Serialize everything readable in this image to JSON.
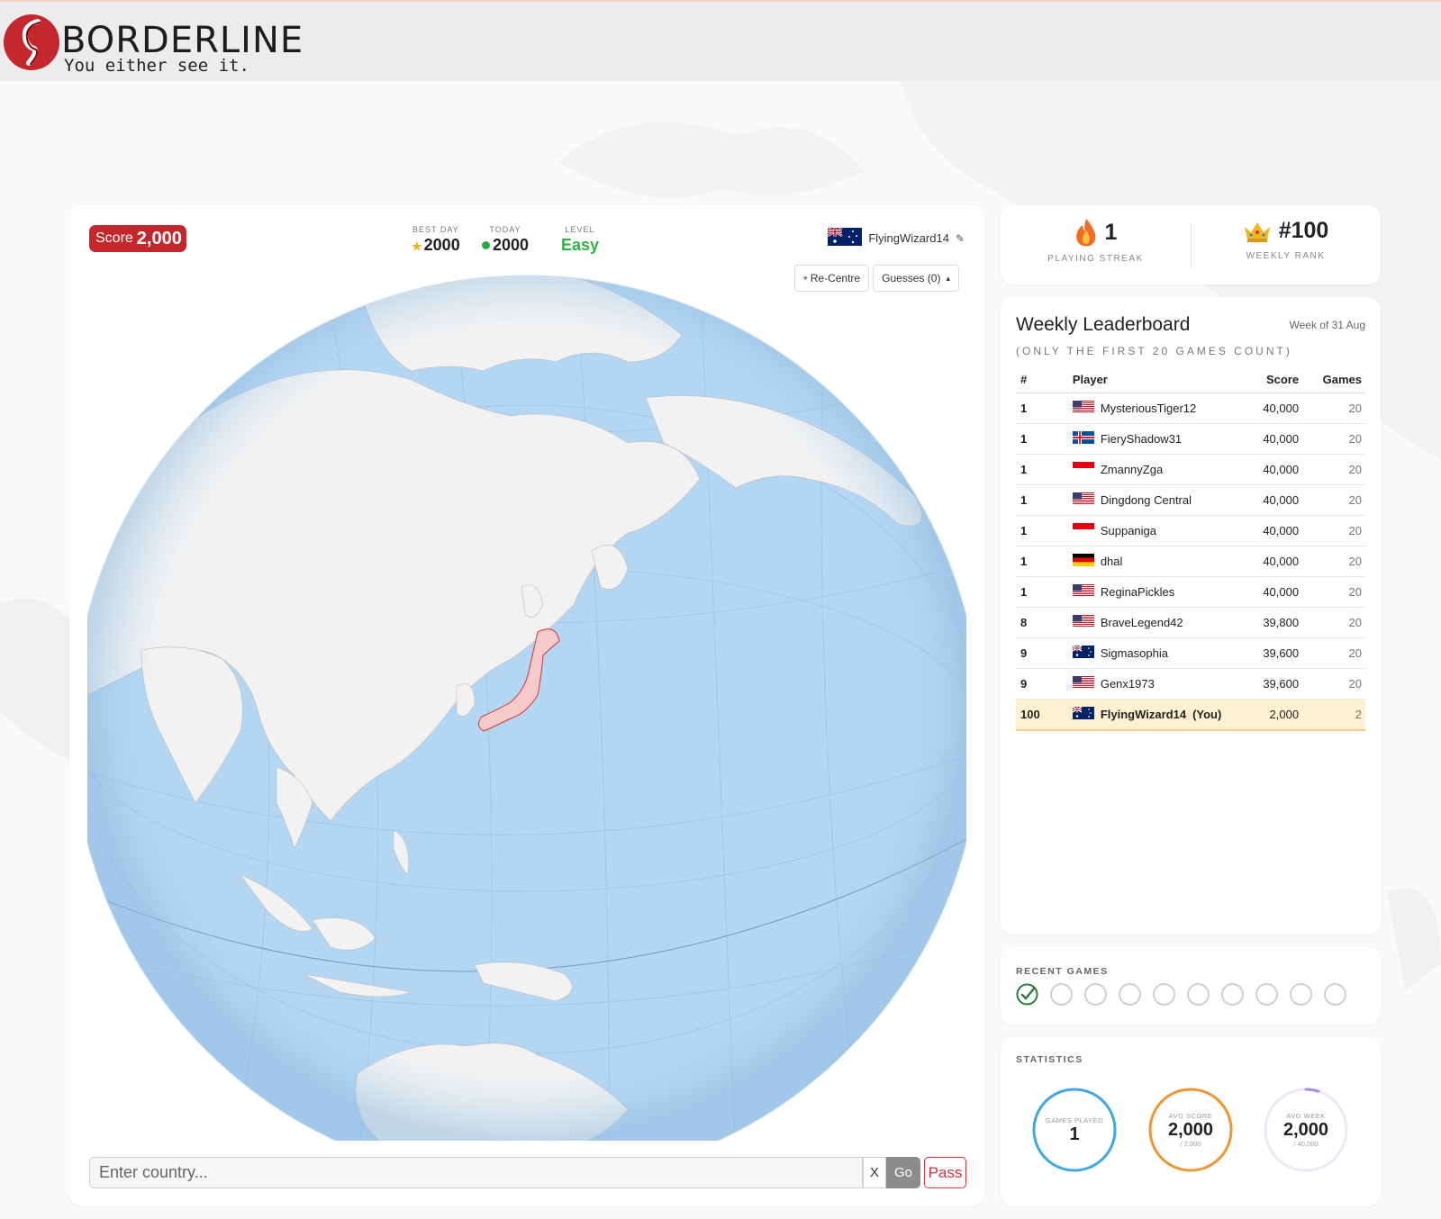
{
  "brand": {
    "title": "BORDERLINE",
    "tagline": "You either see it."
  },
  "colors": {
    "accent_red": "#c5272f",
    "ocean": "#b3d6f3",
    "land": "#f2f2f2",
    "highlight_country": "#f6caca",
    "easy_green": "#2fb34a"
  },
  "game": {
    "score_label": "Score",
    "score_value": "2,000",
    "best_day_label": "BEST DAY",
    "best_day_value": "2000",
    "today_label": "TODAY",
    "today_value": "2000",
    "level_label": "LEVEL",
    "level_value": "Easy",
    "player_name": "FlyingWizard14",
    "player_flag": "australia",
    "recentre_label": "Re-Centre",
    "guesses_label": "Guesses (0)",
    "input_placeholder": "Enter country...",
    "clear_label": "X",
    "go_label": "Go",
    "pass_label": "Pass",
    "highlighted_country": "Japan"
  },
  "streak": {
    "value": "1",
    "label": "PLAYING STREAK",
    "icon": "fire-icon"
  },
  "rank": {
    "value": "#100",
    "label": "WEEKLY RANK",
    "icon": "crown-icon"
  },
  "leaderboard": {
    "title": "Weekly Leaderboard",
    "week": "Week of 31 Aug",
    "note": "(ONLY THE FIRST 20 GAMES COUNT)",
    "columns": {
      "rank": "#",
      "player": "Player",
      "score": "Score",
      "games": "Games"
    },
    "rows": [
      {
        "rank": "1",
        "flag": "usa",
        "player": "MysteriousTiger12",
        "score": "40,000",
        "games": "20"
      },
      {
        "rank": "1",
        "flag": "iceland",
        "player": "FieryShadow31",
        "score": "40,000",
        "games": "20"
      },
      {
        "rank": "1",
        "flag": "indonesia",
        "player": "ZmannyZga",
        "score": "40,000",
        "games": "20"
      },
      {
        "rank": "1",
        "flag": "usa",
        "player": "Dingdong Central",
        "score": "40,000",
        "games": "20"
      },
      {
        "rank": "1",
        "flag": "indonesia",
        "player": "Suppaniga",
        "score": "40,000",
        "games": "20"
      },
      {
        "rank": "1",
        "flag": "germany",
        "player": "dhal",
        "score": "40,000",
        "games": "20"
      },
      {
        "rank": "1",
        "flag": "usa",
        "player": "ReginaPickles",
        "score": "40,000",
        "games": "20"
      },
      {
        "rank": "8",
        "flag": "usa",
        "player": "BraveLegend42",
        "score": "39,800",
        "games": "20"
      },
      {
        "rank": "9",
        "flag": "australia",
        "player": "Sigmasophia",
        "score": "39,600",
        "games": "20"
      },
      {
        "rank": "9",
        "flag": "usa",
        "player": "Genx1973",
        "score": "39,600",
        "games": "20"
      }
    ],
    "me": {
      "rank": "100",
      "flag": "australia",
      "player": "FlyingWizard14",
      "you": "(You)",
      "score": "2,000",
      "games": "2"
    }
  },
  "recent": {
    "label": "RECENT GAMES",
    "games": [
      "correct",
      "empty",
      "empty",
      "empty",
      "empty",
      "empty",
      "empty",
      "empty",
      "empty",
      "empty"
    ]
  },
  "statistics": {
    "label": "STATISTICS",
    "rings": [
      {
        "name": "games-played",
        "caption": "GAMES PLAYED",
        "value": "1",
        "sub": "",
        "color": "#3ea9e0",
        "fraction": 1.0
      },
      {
        "name": "avg-score",
        "caption": "AVG SCORE",
        "value": "2,000",
        "sub": "/ 2,000",
        "color": "#ef9635",
        "fraction": 1.0
      },
      {
        "name": "avg-week",
        "caption": "AVG WEEK",
        "value": "2,000",
        "sub": "/ 40,000",
        "color": "#a88be0",
        "fraction": 0.05
      }
    ]
  }
}
